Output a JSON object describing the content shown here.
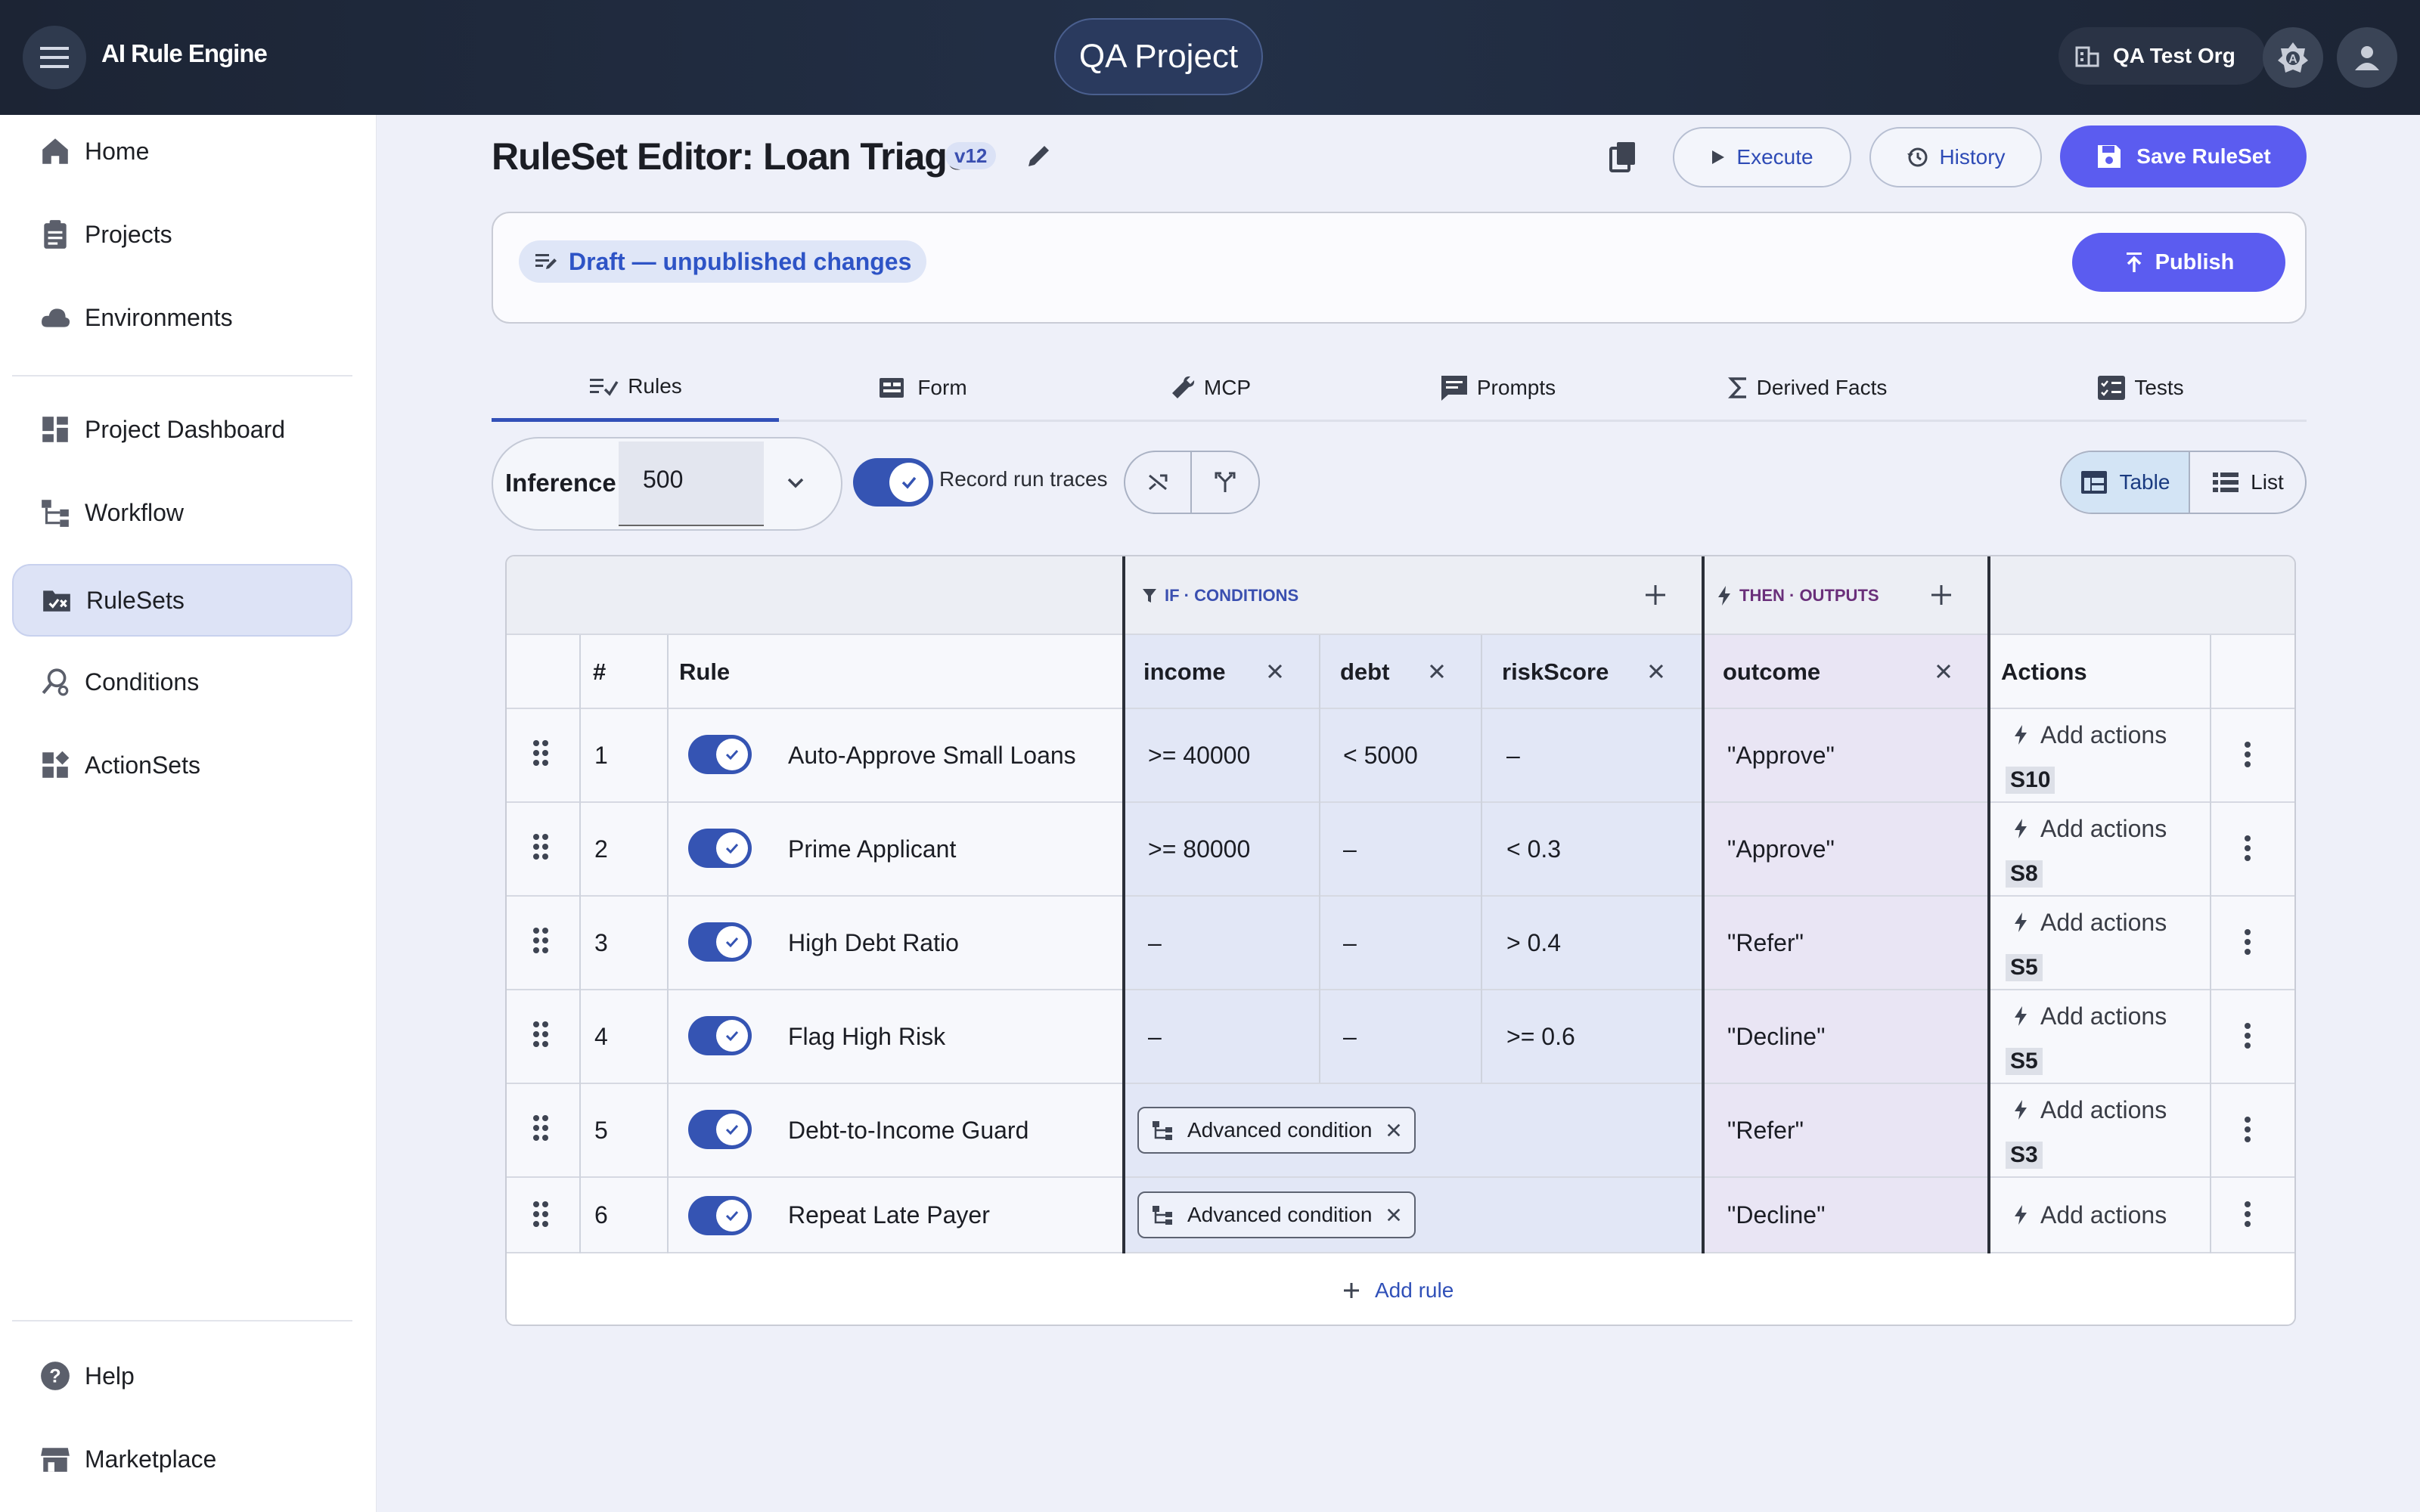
{
  "topbar": {
    "app_title": "AI Rule Engine",
    "project": "QA Project",
    "org": "QA Test Org"
  },
  "sidebar": {
    "items": [
      {
        "label": "Home",
        "icon": "home-icon"
      },
      {
        "label": "Projects",
        "icon": "clipboard-icon"
      },
      {
        "label": "Environments",
        "icon": "cloud-icon"
      },
      {
        "label": "Project Dashboard",
        "icon": "dashboard-icon"
      },
      {
        "label": "Workflow",
        "icon": "workflow-icon"
      },
      {
        "label": "RuleSets",
        "icon": "ruleset-icon",
        "active": true
      },
      {
        "label": "Conditions",
        "icon": "search-gear-icon"
      },
      {
        "label": "ActionSets",
        "icon": "widgets-icon"
      }
    ],
    "footer": [
      {
        "label": "Help",
        "icon": "help-icon"
      },
      {
        "label": "Marketplace",
        "icon": "store-icon"
      }
    ]
  },
  "header": {
    "title": "RuleSet Editor: Loan Triage",
    "version": "v12",
    "execute": "Execute",
    "history": "History",
    "save": "Save RuleSet"
  },
  "draft": {
    "text": "Draft — unpublished changes",
    "publish": "Publish"
  },
  "tabs": [
    "Rules",
    "Form",
    "MCP",
    "Prompts",
    "Derived Facts",
    "Tests"
  ],
  "controls": {
    "inference_label": "Inference",
    "inference_value": "500",
    "record_traces": "Record run traces",
    "view_table": "Table",
    "view_list": "List"
  },
  "table": {
    "if_label": "IF · CONDITIONS",
    "then_label": "THEN · OUTPUTS",
    "col_num": "#",
    "col_rule": "Rule",
    "cond_cols": [
      "income",
      "debt",
      "riskScore"
    ],
    "out_cols": [
      "outcome"
    ],
    "col_actions": "Actions",
    "add_actions": "Add actions",
    "add_rule": "Add rule",
    "rows": [
      {
        "num": "1",
        "name": "Auto-Approve Small Loans",
        "income": ">= 40000",
        "debt": "< 5000",
        "riskScore": "–",
        "outcome": "\"Approve\"",
        "score": "S10"
      },
      {
        "num": "2",
        "name": "Prime Applicant",
        "income": ">= 80000",
        "debt": "–",
        "riskScore": "< 0.3",
        "outcome": "\"Approve\"",
        "score": "S8"
      },
      {
        "num": "3",
        "name": "High Debt Ratio",
        "income": "–",
        "debt": "–",
        "riskScore": "> 0.4",
        "outcome": "\"Refer\"",
        "score": "S5"
      },
      {
        "num": "4",
        "name": "Flag High Risk",
        "income": "–",
        "debt": "–",
        "riskScore": ">= 0.6",
        "outcome": "\"Decline\"",
        "score": "S5"
      },
      {
        "num": "5",
        "name": "Debt-to-Income Guard",
        "advanced": "Advanced condition",
        "outcome": "\"Refer\"",
        "score": "S3"
      },
      {
        "num": "6",
        "name": "Repeat Late Payer",
        "advanced": "Advanced condition",
        "outcome": "\"Decline\"",
        "score": ""
      }
    ]
  }
}
